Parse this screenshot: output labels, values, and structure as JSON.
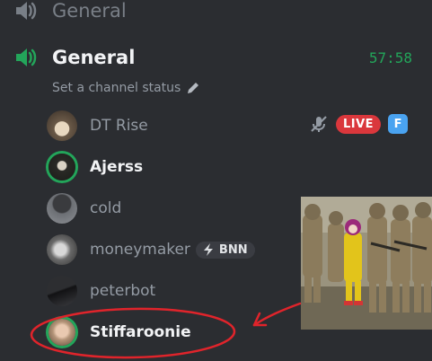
{
  "channels": [
    {
      "name": "General"
    },
    {
      "name": "General",
      "timer": "57:58"
    }
  ],
  "status": {
    "placeholder": "Set a channel status"
  },
  "users": [
    {
      "name": "DT Rise",
      "live_label": "LIVE",
      "f_badge": "F"
    },
    {
      "name": "Ajerss"
    },
    {
      "name": "cold"
    },
    {
      "name": "moneymaker",
      "tag": "BNN"
    },
    {
      "name": "peterbot"
    },
    {
      "name": "Stiffaroonie"
    }
  ],
  "colors": {
    "speaking": "#23a55a",
    "live": "#da373c",
    "annotation": "#e0242b"
  },
  "icons": [
    "speaker-icon",
    "pencil-icon",
    "muted-mic-icon",
    "bolt-icon"
  ]
}
